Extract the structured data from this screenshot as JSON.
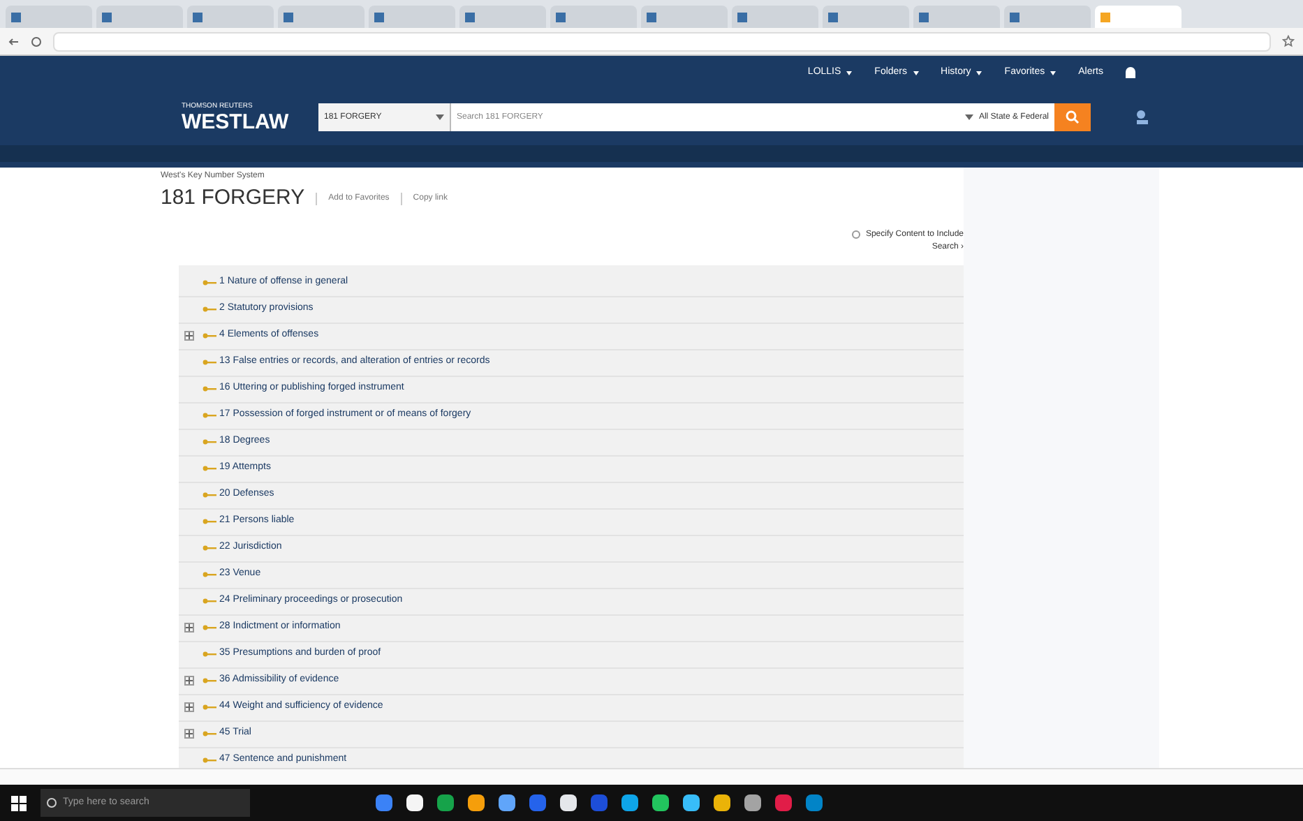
{
  "browser_tabs": [
    {
      "selected": false
    },
    {
      "selected": false
    },
    {
      "selected": false
    },
    {
      "selected": false
    },
    {
      "selected": false
    },
    {
      "selected": false
    },
    {
      "selected": false
    },
    {
      "selected": false
    },
    {
      "selected": false
    },
    {
      "selected": false
    },
    {
      "selected": false
    },
    {
      "selected": false
    },
    {
      "selected": true
    }
  ],
  "header_nav": [
    {
      "label": "LOLLIS",
      "kind": "menu"
    },
    {
      "label": "Folders",
      "kind": "menu"
    },
    {
      "label": "History",
      "kind": "menu"
    },
    {
      "label": "Favorites",
      "kind": "menu"
    },
    {
      "label": "Alerts",
      "kind": "plain"
    }
  ],
  "brand": {
    "publisher": "THOMSON REUTERS",
    "product": "WESTLAW"
  },
  "search": {
    "scope": "181 FORGERY",
    "placeholder": "Search 181 FORGERY",
    "jurisdiction": "All State & Federal"
  },
  "breadcrumb": "West's Key Number System",
  "page_title": "181 FORGERY",
  "title_actions": [
    "Add to Favorites",
    "Copy link"
  ],
  "specify_content": {
    "label": "Specify Content to Include",
    "checked": false
  },
  "search_link": "Search ›",
  "outline": [
    {
      "label": "1 Nature of offense in general",
      "expandable": false
    },
    {
      "label": "2 Statutory provisions",
      "expandable": false
    },
    {
      "label": "4 Elements of offenses",
      "expandable": true
    },
    {
      "label": "13 False entries or records, and alteration of entries or records",
      "expandable": false
    },
    {
      "label": "16 Uttering or publishing forged instrument",
      "expandable": false
    },
    {
      "label": "17 Possession of forged instrument or of means of forgery",
      "expandable": false
    },
    {
      "label": "18 Degrees",
      "expandable": false
    },
    {
      "label": "19 Attempts",
      "expandable": false
    },
    {
      "label": "20 Defenses",
      "expandable": false
    },
    {
      "label": "21 Persons liable",
      "expandable": false
    },
    {
      "label": "22 Jurisdiction",
      "expandable": false
    },
    {
      "label": "23 Venue",
      "expandable": false
    },
    {
      "label": "24 Preliminary proceedings or prosecution",
      "expandable": false
    },
    {
      "label": "28 Indictment or information",
      "expandable": true
    },
    {
      "label": "35 Presumptions and burden of proof",
      "expandable": false
    },
    {
      "label": "36 Admissibility of evidence",
      "expandable": true
    },
    {
      "label": "44 Weight and sufficiency of evidence",
      "expandable": true
    },
    {
      "label": "45 Trial",
      "expandable": true
    },
    {
      "label": "47 Sentence and punishment",
      "expandable": false
    }
  ],
  "taskbar": {
    "search_placeholder": "Type here to search"
  }
}
